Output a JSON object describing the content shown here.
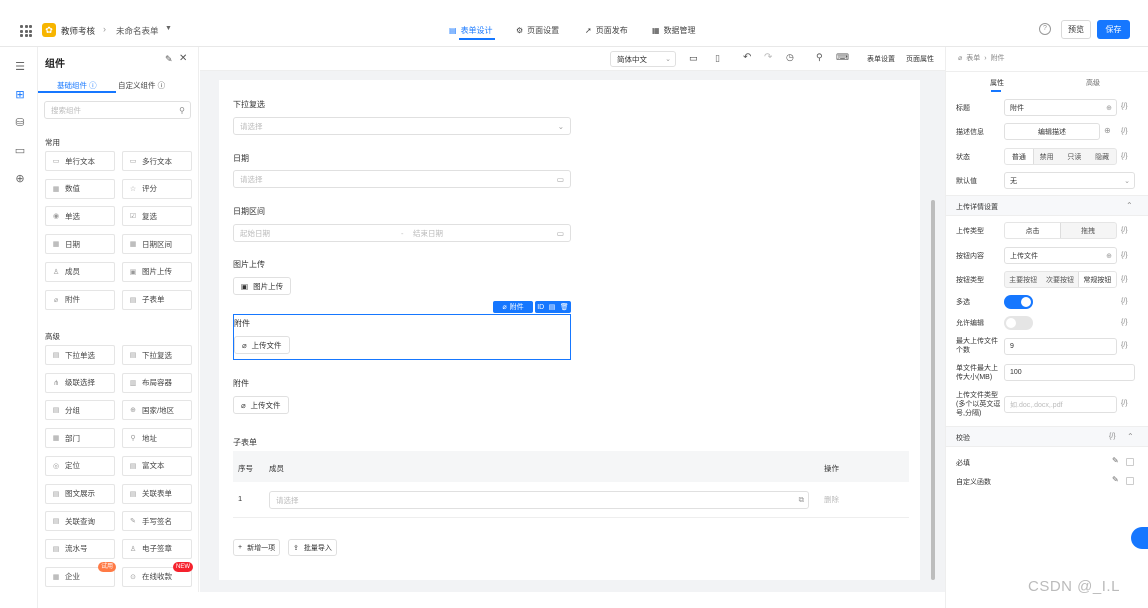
{
  "app": {
    "name": "教师考核",
    "form_name": "未命名表单"
  },
  "top_tabs": [
    {
      "label": "表单设计",
      "icon": "file-icon",
      "active": true
    },
    {
      "label": "页面设置",
      "icon": "gear-icon",
      "active": false
    },
    {
      "label": "页面发布",
      "icon": "send-icon",
      "active": false
    },
    {
      "label": "数据管理",
      "icon": "table-icon",
      "active": false
    }
  ],
  "actions": {
    "preview": "预览",
    "save": "保存"
  },
  "left_panel": {
    "title": "组件",
    "tabs": [
      "基础组件",
      "自定义组件"
    ],
    "search_placeholder": "搜索组件",
    "groups": [
      {
        "title": "常用",
        "items": [
          "单行文本",
          "多行文本",
          "数值",
          "评分",
          "单选",
          "复选",
          "日期",
          "日期区间",
          "成员",
          "图片上传",
          "附件",
          "子表单"
        ]
      },
      {
        "title": "高级",
        "items": [
          "下拉单选",
          "下拉复选",
          "级联选择",
          "布局容器",
          "分组",
          "国家/地区",
          "部门",
          "地址",
          "定位",
          "富文本",
          "图文展示",
          "关联表单",
          "关联查询",
          "手写签名",
          "流水号",
          "电子签章",
          "企业",
          "在线收款"
        ]
      }
    ],
    "badges": {
      "trial": "试用",
      "new": "NEW"
    }
  },
  "toolbar": {
    "language": "简体中文",
    "form_settings": "表单设置",
    "page_props": "页面属性"
  },
  "form": {
    "dropdown_multi": {
      "label": "下拉复选",
      "placeholder": "请选择"
    },
    "date": {
      "label": "日期",
      "placeholder": "请选择"
    },
    "date_range": {
      "label": "日期区间",
      "start": "起始日期",
      "sep": "-",
      "end": "结束日期"
    },
    "image_upload": {
      "label": "图片上传",
      "button": "图片上传"
    },
    "attachment_selected": {
      "label": "附件",
      "button": "上传文件",
      "chip": "附件",
      "chip_id": "ID"
    },
    "attachment": {
      "label": "附件",
      "button": "上传文件"
    },
    "subform": {
      "label": "子表单",
      "columns": [
        "序号",
        "成员",
        "操作"
      ],
      "rows": [
        {
          "index": "1",
          "placeholder": "请选择",
          "action": "删除"
        }
      ],
      "add": "新增一项",
      "import": "批量导入"
    }
  },
  "right_panel": {
    "breadcrumb": [
      "表单",
      "附件"
    ],
    "tabs": [
      "属性",
      "高级"
    ],
    "props": {
      "title_label": "标题",
      "title_value": "附件",
      "desc_label": "描述信息",
      "desc_value": "编辑描述",
      "state_label": "状态",
      "states": [
        "普通",
        "禁用",
        "只读",
        "隐藏"
      ],
      "default_label": "默认值",
      "default_value": "无"
    },
    "upload_section": "上传详情设置",
    "upload": {
      "type_label": "上传类型",
      "types": [
        "点击",
        "拖拽"
      ],
      "btn_content_label": "按钮内容",
      "btn_content_value": "上传文件",
      "btn_type_label": "按钮类型",
      "btn_types": [
        "主要按钮",
        "次要按钮",
        "常规按钮"
      ],
      "multi_label": "多选",
      "multi_on": true,
      "edit_label": "允许编辑",
      "edit_on": false,
      "max_count_label": "最大上传文件个数",
      "max_count_value": "9",
      "max_size_label": "单文件最大上传大小(MB)",
      "max_size_value": "100",
      "file_types_label": "上传文件类型(多个以英文逗号,分隔)",
      "file_types_placeholder": "如.doc,.docx,.pdf"
    },
    "validate_section": "校验",
    "validate": {
      "required": "必填",
      "custom": "自定义函数"
    },
    "fx": "{/}"
  },
  "watermark": "CSDN @_I.L"
}
